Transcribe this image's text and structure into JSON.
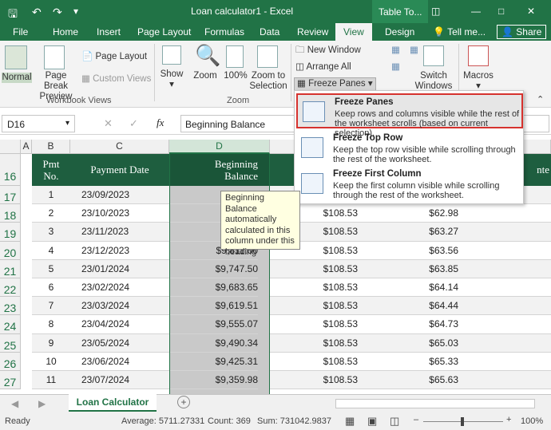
{
  "titlebar": {
    "title": "Loan calculator1 - Excel",
    "context": "Table To..."
  },
  "tabs": [
    "File",
    "Home",
    "Insert",
    "Page Layout",
    "Formulas",
    "Data",
    "Review",
    "View",
    "Design",
    "Tell me...",
    "Share"
  ],
  "ribbon": {
    "normal": "Normal",
    "page_break": [
      "Page Break",
      "Preview"
    ],
    "page_layout": "Page Layout",
    "custom_views": "Custom Views",
    "show": "Show",
    "zoom": "Zoom",
    "zoom100": "100%",
    "zoom_sel": [
      "Zoom to",
      "Selection"
    ],
    "new_window": "New Window",
    "arrange_all": "Arrange All",
    "freeze_panes": "Freeze Panes",
    "switch": [
      "Switch",
      "Windows"
    ],
    "macros": "Macros",
    "group_workbook": "Workbook Views",
    "group_zoom": "Zoom"
  },
  "formula": {
    "namebox": "D16",
    "fx": "fx",
    "value": "Beginning Balance"
  },
  "columns": [
    "A",
    "B",
    "C",
    "D"
  ],
  "col_last": "E",
  "rows": [
    "16",
    "17",
    "18",
    "19",
    "20",
    "21",
    "22",
    "23",
    "24",
    "25",
    "26",
    "27"
  ],
  "header": {
    "pmt": [
      "Pmt",
      "No."
    ],
    "date": "Payment Date",
    "bal": [
      "Beginning",
      "Balance"
    ],
    "partial": "nte"
  },
  "data": [
    {
      "n": "1",
      "d": "23/09/2023",
      "b": "$1",
      "p": "",
      "i": ""
    },
    {
      "n": "2",
      "d": "23/10/2023",
      "b": "$",
      "p": "",
      "i": ""
    },
    {
      "n": "3",
      "d": "23/11/2023",
      "b": "$",
      "p": "$108.53",
      "i": "$63.27"
    },
    {
      "n": "4",
      "d": "23/12/2023",
      "b": "$9,811.00",
      "p": "$108.53",
      "i": "$63.56"
    },
    {
      "n": "5",
      "d": "23/01/2024",
      "b": "$9,747.50",
      "p": "$108.53",
      "i": "$63.85"
    },
    {
      "n": "6",
      "d": "23/02/2024",
      "b": "$9,683.65",
      "p": "$108.53",
      "i": "$64.14"
    },
    {
      "n": "7",
      "d": "23/03/2024",
      "b": "$9,619.51",
      "p": "$108.53",
      "i": "$64.44"
    },
    {
      "n": "8",
      "d": "23/04/2024",
      "b": "$9,555.07",
      "p": "$108.53",
      "i": "$64.73"
    },
    {
      "n": "9",
      "d": "23/05/2024",
      "b": "$9,490.34",
      "p": "$108.53",
      "i": "$65.03"
    },
    {
      "n": "10",
      "d": "23/06/2024",
      "b": "$9,425.31",
      "p": "$108.53",
      "i": "$65.33"
    },
    {
      "n": "11",
      "d": "23/07/2024",
      "b": "$9,359.98",
      "p": "$108.53",
      "i": "$65.63"
    }
  ],
  "row2_vals": {
    "p": "$108.53",
    "i": "$62.98"
  },
  "menu": [
    {
      "title": "Freeze Panes",
      "desc": "Keep rows and columns visible while the rest of the worksheet scrolls (based on current selection)."
    },
    {
      "title": "Freeze Top Row",
      "desc": "Keep the top row visible while scrolling through the rest of the worksheet."
    },
    {
      "title": "Freeze First Column",
      "desc": "Keep the first column visible while scrolling through the rest of the worksheet."
    }
  ],
  "tooltip": "Beginning Balance automatically calculated in this column under this heading",
  "sheet_tab": "Loan Calculator",
  "status": {
    "ready": "Ready",
    "avg": "Average: 5711.27331",
    "count": "Count: 369",
    "sum": "Sum: 731042.9837",
    "zoom": "100%"
  },
  "colors": {
    "green": "#217346",
    "dark_header": "#1e5e3f",
    "highlight": "#d6322e"
  }
}
